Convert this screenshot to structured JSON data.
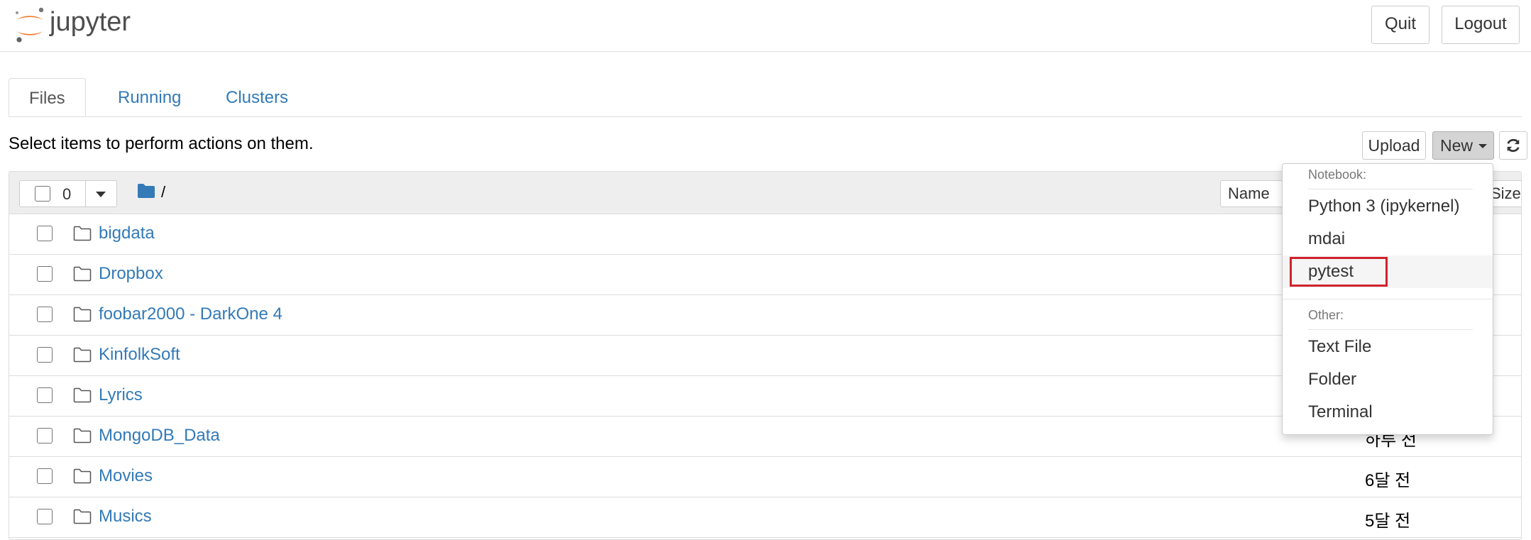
{
  "header": {
    "logo_text": "jupyter",
    "quit_label": "Quit",
    "logout_label": "Logout"
  },
  "tabs": [
    {
      "label": "Files",
      "active": true
    },
    {
      "label": "Running",
      "active": false
    },
    {
      "label": "Clusters",
      "active": false
    }
  ],
  "toolbar": {
    "instructions": "Select items to perform actions on them.",
    "upload_label": "Upload",
    "new_label": "New",
    "refresh_icon": "refresh-icon"
  },
  "list_header": {
    "selected_count": "0",
    "breadcrumb_path": "/",
    "sort_name_label": "Name",
    "sort_size_label": "Size"
  },
  "items": [
    {
      "name": "bigdata",
      "modified": ""
    },
    {
      "name": "Dropbox",
      "modified": ""
    },
    {
      "name": "foobar2000 - DarkOne 4",
      "modified": ""
    },
    {
      "name": "KinfolkSoft",
      "modified": ""
    },
    {
      "name": "Lyrics",
      "modified": ""
    },
    {
      "name": "MongoDB_Data",
      "modified": "하루 전"
    },
    {
      "name": "Movies",
      "modified": "6달 전"
    },
    {
      "name": "Musics",
      "modified": "5달 전"
    }
  ],
  "new_menu": {
    "notebook_header": "Notebook:",
    "notebook_items": [
      "Python 3 (ipykernel)",
      "mdai",
      "pytest"
    ],
    "other_header": "Other:",
    "other_items": [
      "Text File",
      "Folder",
      "Terminal"
    ],
    "highlighted_item": "pytest"
  },
  "colors": {
    "link": "#337ab7",
    "logo_orange": "#f37726",
    "highlight_border": "#d0222c"
  }
}
